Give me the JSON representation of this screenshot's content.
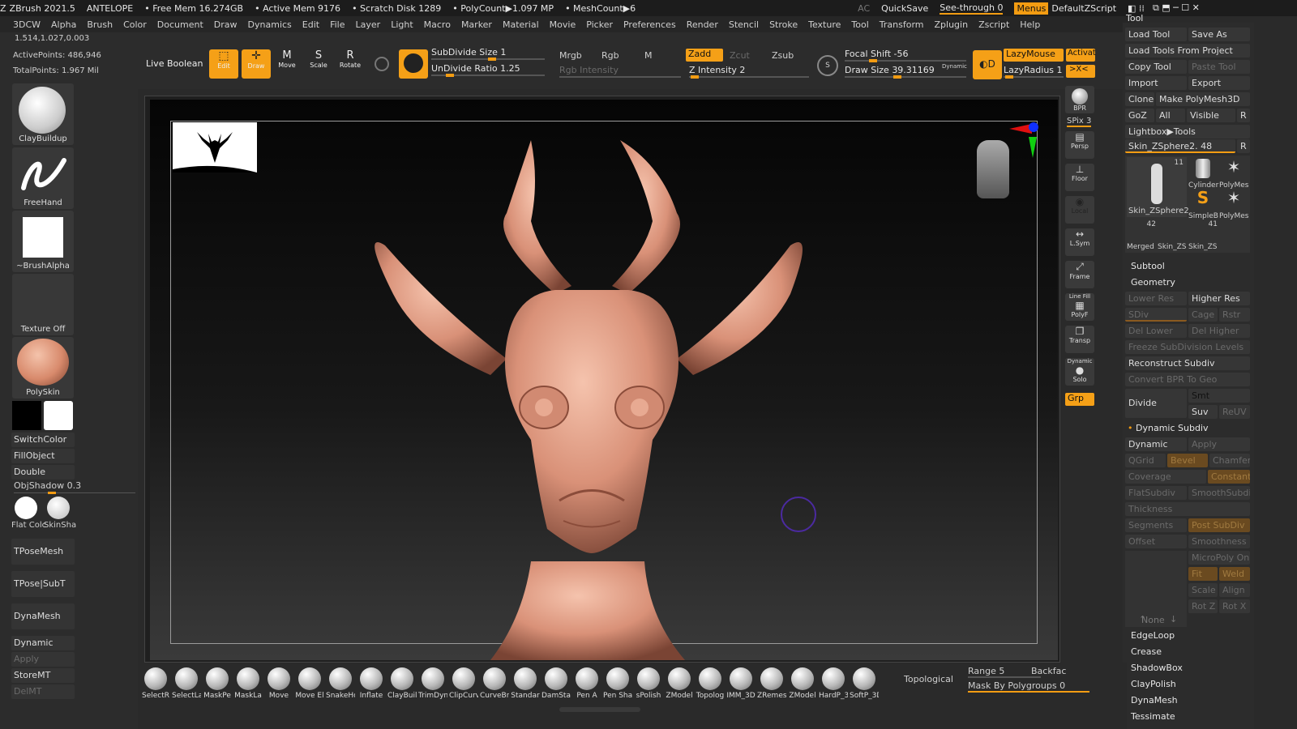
{
  "titlebar": {
    "app": "ZBrush 2021.5",
    "project": "ANTELOPE",
    "free_mem": "• Free Mem 16.274GB",
    "active_mem": "• Active Mem 9176",
    "scratch": "• Scratch Disk 1289",
    "polycount": "• PolyCount▶1.097 MP",
    "meshcount": "• MeshCount▶6",
    "ac": "AC",
    "quicksave": "QuickSave",
    "seethrough": "See-through 0",
    "menus": "Menus",
    "script": "DefaultZScript"
  },
  "menubar": [
    "3DCW",
    "Alpha",
    "Brush",
    "Color",
    "Document",
    "Draw",
    "Dynamics",
    "Edit",
    "File",
    "Layer",
    "Light",
    "Macro",
    "Marker",
    "Material",
    "Movie",
    "Picker",
    "Preferences",
    "Render",
    "Stencil",
    "Stroke",
    "Texture",
    "Tool",
    "Transform",
    "Zplugin",
    "Zscript",
    "Help"
  ],
  "info": {
    "coords": "1.514,1.027,0.003",
    "active_points": "ActivePoints: 486,946",
    "total_points": "TotalPoints: 1.967 Mil"
  },
  "left": {
    "brush1": "ClayBuildup",
    "brush2": "FreeHand",
    "alpha": "~BrushAlpha",
    "texture": "Texture Off",
    "material": "PolySkin",
    "switchcolor": "SwitchColor",
    "fillobject": "FillObject",
    "double": "Double",
    "objshadow": "ObjShadow",
    "objshadow_val": "0.3",
    "flatcolor": "Flat Colc",
    "skinshade": "SkinSha",
    "tposemesh": "TPoseMesh",
    "tposesubt": "TPose|SubT",
    "dynamesh": "DynaMesh",
    "dynamic": "Dynamic",
    "apply": "Apply",
    "storemt": "StoreMT",
    "delmt": "DelMT"
  },
  "shelf": {
    "live_boolean": "Live Boolean",
    "edit": "Edit",
    "draw": "Draw",
    "move": "Move",
    "scale": "Scale",
    "rotate": "Rotate",
    "subdivide_size": "SubDivide Size",
    "subdivide_val": "1",
    "undivide_ratio": "UnDivide Ratio",
    "undivide_val": "1.25",
    "mrgb": "Mrgb",
    "rgb": "Rgb",
    "m": "M",
    "rgb_intensity": "Rgb Intensity",
    "zadd": "Zadd",
    "zcut": "Zcut",
    "zsub": "Zsub",
    "z_intensity": "Z Intensity",
    "z_intensity_val": "2",
    "focal_shift": "Focal Shift",
    "focal_val": "-56",
    "draw_size": "Draw Size",
    "draw_size_val": "39.31169",
    "dynamic": "Dynamic",
    "lazymouse": "LazyMouse",
    "lazyradius": "LazyRadius",
    "lazyradius_val": "1",
    "activate": "Activat",
    "xc": ">X<"
  },
  "righttools": {
    "bpr": "BPR",
    "spix": "SPix 3",
    "persp": "Persp",
    "floor": "Floor",
    "local": "Local",
    "lsym": "L.Sym",
    "frame": "Frame",
    "polyf": "PolyF",
    "linefill": "Line Fill",
    "transp": "Transp",
    "solo": "Solo",
    "dynamic": "Dynamic",
    "grp": "Grp"
  },
  "rpanel": {
    "tool_header": "Tool",
    "load_tool": "Load Tool",
    "save_as": "Save As",
    "load_tools_project": "Load Tools From Project",
    "copy_tool": "Copy Tool",
    "paste_tool": "Paste Tool",
    "import": "Import",
    "export": "Export",
    "clone": "Clone",
    "make_polymesh": "Make PolyMesh3D",
    "goz": "GoZ",
    "all": "All",
    "visible": "Visible",
    "r": "R",
    "lightbox_tools": "Lightbox▶Tools",
    "current_tool": "Skin_ZSphere2. 48",
    "thumbs": [
      {
        "label": "Skin_ZSphere2",
        "count": "11"
      },
      {
        "label": "Cylinder",
        "count": ""
      },
      {
        "label": "PolyMes",
        "count": ""
      },
      {
        "label": "SimpleB",
        "count": ""
      },
      {
        "label": "PolyMes",
        "count": ""
      },
      {
        "label": "Merged",
        "count": "42"
      },
      {
        "label": "Skin_ZS",
        "count": ""
      },
      {
        "label": "Skin_ZS",
        "count": "41"
      }
    ],
    "subtool": "Subtool",
    "geometry": "Geometry",
    "lower_res": "Lower Res",
    "higher_res": "Higher Res",
    "sdiv": "SDiv",
    "cage": "Cage",
    "rstr": "Rstr",
    "del_lower": "Del Lower",
    "del_higher": "Del Higher",
    "freeze": "Freeze SubDivision Levels",
    "reconstruct": "Reconstruct Subdiv",
    "convert_bpr": "Convert BPR To Geo",
    "divide": "Divide",
    "smt": "Smt",
    "suv": "Suv",
    "reuv": "ReUV",
    "dynamic_subdiv": "Dynamic Subdiv",
    "ds_dynamic": "Dynamic",
    "ds_apply": "Apply",
    "qgrid": "QGrid",
    "bevel": "Bevel",
    "chamfer": "Chamfer",
    "coverage": "Coverage",
    "constant": "Constant",
    "flatsubdiv": "FlatSubdiv",
    "smoothsubdiv": "SmoothSubdiv",
    "thickness": "Thickness",
    "segments": "Segments",
    "post_subdiv": "Post SubDiv",
    "offset": "Offset",
    "smoothness": "Smoothness",
    "micropoly": "MicroPoly On",
    "fit": "Fit",
    "weld": "Weld",
    "scale": "Scale",
    "align": "Align",
    "none": "None",
    "rotz": "Rot Z",
    "rotx": "Rot X",
    "edgeloop": "EdgeLoop",
    "crease": "Crease",
    "shadowbox": "ShadowBox",
    "claypolish": "ClayPolish",
    "dynamesh": "DynaMesh",
    "tessimate": "Tessimate"
  },
  "bottom": {
    "brushes": [
      "SelectR",
      "SelectLa",
      "MaskPe",
      "MaskLa",
      "Move",
      "Move El",
      "SnakeHo",
      "Inflate",
      "ClayBuil",
      "TrimDyn",
      "ClipCurv",
      "CurveBr",
      "Standar",
      "DamSta",
      "Pen A",
      "Pen Sha",
      "sPolish",
      "ZModel",
      "Topolog",
      "IMM_3D",
      "ZRemes",
      "ZModel",
      "HardP_3",
      "SoftP_3D"
    ],
    "topological": "Topological",
    "range": "Range 5",
    "backface": "Backfac",
    "mask_polygroups": "Mask By Polygroups 0"
  },
  "colors": {
    "accent": "#f5a017",
    "skin": "#e8a78c",
    "bg": "#2c2c2c"
  }
}
